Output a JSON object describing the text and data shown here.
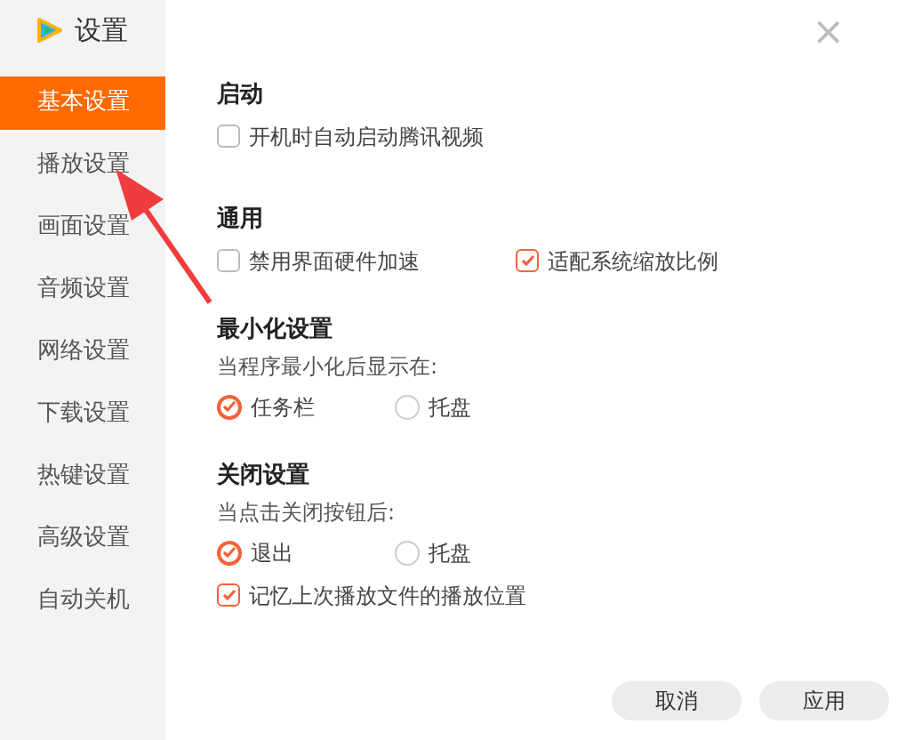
{
  "window": {
    "title": "设置",
    "close": "×"
  },
  "sidebar": {
    "items": [
      {
        "label": "基本设置",
        "selected": true
      },
      {
        "label": "播放设置",
        "selected": false
      },
      {
        "label": "画面设置",
        "selected": false
      },
      {
        "label": "音频设置",
        "selected": false
      },
      {
        "label": "网络设置",
        "selected": false
      },
      {
        "label": "下载设置",
        "selected": false
      },
      {
        "label": "热键设置",
        "selected": false
      },
      {
        "label": "高级设置",
        "selected": false
      },
      {
        "label": "自动关机",
        "selected": false
      }
    ]
  },
  "sections": [
    {
      "title": "启动",
      "rows": [
        [
          {
            "kind": "checkbox",
            "label": "开机时自动启动腾讯视频",
            "checked": false
          }
        ]
      ]
    },
    {
      "title": "通用",
      "rows": [
        [
          {
            "kind": "checkbox",
            "label": "禁用界面硬件加速",
            "checked": false
          },
          {
            "kind": "checkbox",
            "label": "适配系统缩放比例",
            "checked": true
          }
        ]
      ]
    },
    {
      "title": "最小化设置",
      "note": "当程序最小化后显示在:",
      "rows": [
        [
          {
            "kind": "radio",
            "label": "任务栏",
            "selected": true
          },
          {
            "kind": "radio",
            "label": "托盘",
            "selected": false
          }
        ]
      ]
    },
    {
      "title": "关闭设置",
      "note": "当点击关闭按钮后:",
      "rows": [
        [
          {
            "kind": "radio",
            "label": "退出",
            "selected": true
          },
          {
            "kind": "radio",
            "label": "托盘",
            "selected": false
          }
        ],
        [
          {
            "kind": "checkbox",
            "label": "记忆上次播放文件的播放位置",
            "checked": true
          }
        ]
      ]
    }
  ],
  "buttons": [
    "取消",
    "应用"
  ]
}
